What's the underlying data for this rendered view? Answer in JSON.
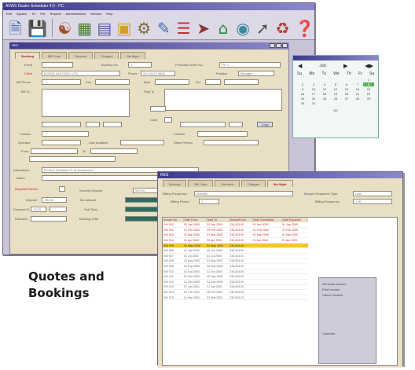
{
  "caption": "Quotes and\nBookings",
  "back_window": {
    "title": "AVWS Dealer Scheduler 4.0 - PC",
    "menu": [
      "Edit",
      "System",
      "Tcl",
      "File",
      "Reports",
      "Administration",
      "Window",
      "Help"
    ],
    "inner_title": "RES",
    "tabs": [
      "Booking",
      "Bill Code",
      "Services",
      "Charges",
      "Itin Mgnt"
    ],
    "labels": {
      "event": "Event",
      "booking_no": "Booking No.",
      "purchase_order": "Purchase Order No.",
      "client": "Client",
      "phone": "Phone",
      "position": "Position",
      "bill_phone": "Bill Phone",
      "fax": "Fax",
      "mobile": "Mob",
      "ext": "Ext",
      "bill_to": "Bill To",
      "ship_to": "Ship To",
      "contact": "Contact",
      "operator": "Operator",
      "last_updated": "Last Updated",
      "sales_person": "Sales Person",
      "from": "From",
      "to": "To",
      "instructions": "Instructions",
      "notes": "Notes",
      "required_return": "Required Return",
      "security_deposit": "Security Deposit",
      "deposit": "Deposit",
      "discount": "Discount %",
      "discount2": "Discount",
      "tax_amount": "Tax Amount",
      "sub_total": "Sub Total",
      "booking_total": "Booking Total"
    },
    "values": {
      "booking_no": "1",
      "client_name": "BORDE ANTHONY LTD",
      "fax_value": "03 9 9079 3855",
      "purchase_order": "PO 1",
      "position": "Manager",
      "instructions": "PO Box Zeldabes Ct 5s Booked/pd",
      "deposit": "250.00",
      "discount": "10.00",
      "security_deposit": "500.00"
    },
    "buttons": {
      "copy": "Copy",
      "get": "Get",
      "ok": "OK",
      "cancel": "Cancel"
    }
  },
  "calendar": {
    "month": "July",
    "weekdays": [
      "Su",
      "Mo",
      "Tu",
      "We",
      "Th",
      "Fr",
      "Sa"
    ],
    "days": [
      "",
      "",
      "",
      "",
      "",
      "",
      "1",
      "2",
      "3",
      "4",
      "5",
      "6",
      "7",
      "8",
      "9",
      "10",
      "11",
      "12",
      "13",
      "14",
      "15",
      "16",
      "17",
      "18",
      "19",
      "20",
      "21",
      "22",
      "23",
      "24",
      "25",
      "26",
      "27",
      "28",
      "29",
      "30",
      "31"
    ],
    "highlight": "8",
    "footer": "OK"
  },
  "front_window": {
    "title": "RES",
    "tabs": [
      "Booking",
      "Bill Code",
      "Services",
      "Charges",
      "Itin Mgnt"
    ],
    "billing_frequency_label": "Billing Frequency",
    "billing_frequency": "Monthly",
    "billing_period_label": "Billing Period",
    "billing_period": "1",
    "merged_sequence_label": "Merged Sequence Type",
    "merged_sequence": "Last",
    "billing_frequency2_label": "Billing Frequency",
    "billing_frequency2": "1.00",
    "columns": [
      "Invoice No.",
      "Date From",
      "Date To",
      "Amount Due",
      "Date Committed",
      "Date Exported"
    ],
    "rows": [
      [
        "INV 001",
        "01 Jan 2000",
        "31 Jan 2000",
        "234,003.00",
        "01 Jan 2000",
        "01 Jan 2000"
      ],
      [
        "INV 002",
        "01 Feb 2000",
        "29 Feb 2000",
        "234,003.00",
        "01 Feb 2000",
        "01 Feb 2000"
      ],
      [
        "INV 003",
        "01 Mar 2000",
        "31 Mar 2000",
        "234,003.00",
        "01 Mar 2000",
        "01 Mar 2000"
      ],
      [
        "INV 004",
        "01 Apr 2000",
        "30 Apr 2000",
        "234,003.00",
        "01 Apr 2000",
        "01 Apr 2000"
      ],
      [
        "INV 005",
        "01 May 2000",
        "31 May 2000",
        "234,003.00",
        "",
        ""
      ],
      [
        "INV 006",
        "01 Jun 2000",
        "30 Jun 2000",
        "234,003.00",
        "",
        ""
      ],
      [
        "INV 007",
        "01 Jul 2000",
        "31 Jul 2000",
        "234,003.00",
        "",
        ""
      ],
      [
        "INV 008",
        "01 Aug 2000",
        "31 Aug 2000",
        "234,003.00",
        "",
        ""
      ],
      [
        "INV 009",
        "01 Sep 2000",
        "30 Sep 2000",
        "234,003.00",
        "",
        ""
      ],
      [
        "INV 010",
        "01 Oct 2000",
        "31 Oct 2000",
        "234,003.00",
        "",
        ""
      ],
      [
        "INV 011",
        "01 Nov 2000",
        "30 Nov 2000",
        "234,003.00",
        "",
        ""
      ],
      [
        "INV 012",
        "01 Dec 2000",
        "31 Dec 2000",
        "234,003.00",
        "",
        ""
      ],
      [
        "INV 013",
        "01 Jan 2001",
        "31 Jan 2001",
        "234,003.00",
        "",
        ""
      ],
      [
        "INV 014",
        "01 Feb 2001",
        "28 Feb 2001",
        "234,003.00",
        "",
        ""
      ],
      [
        "INV 015",
        "01 Mar 2001",
        "31 Mar 2001",
        "234,003.00",
        "",
        ""
      ]
    ],
    "selected_row": 4,
    "context_menu": [
      "Generate Invoice",
      "Print Invoice",
      "Cancel Invoice",
      "",
      "",
      "",
      "",
      "",
      "",
      "Calendar"
    ]
  },
  "colors": {
    "title_start": "#3d3a8c",
    "title_end": "#8c88c8",
    "form_bg": "#e8dfc4",
    "selected_row": "#f3c62b",
    "accent_red": "#c02020"
  }
}
